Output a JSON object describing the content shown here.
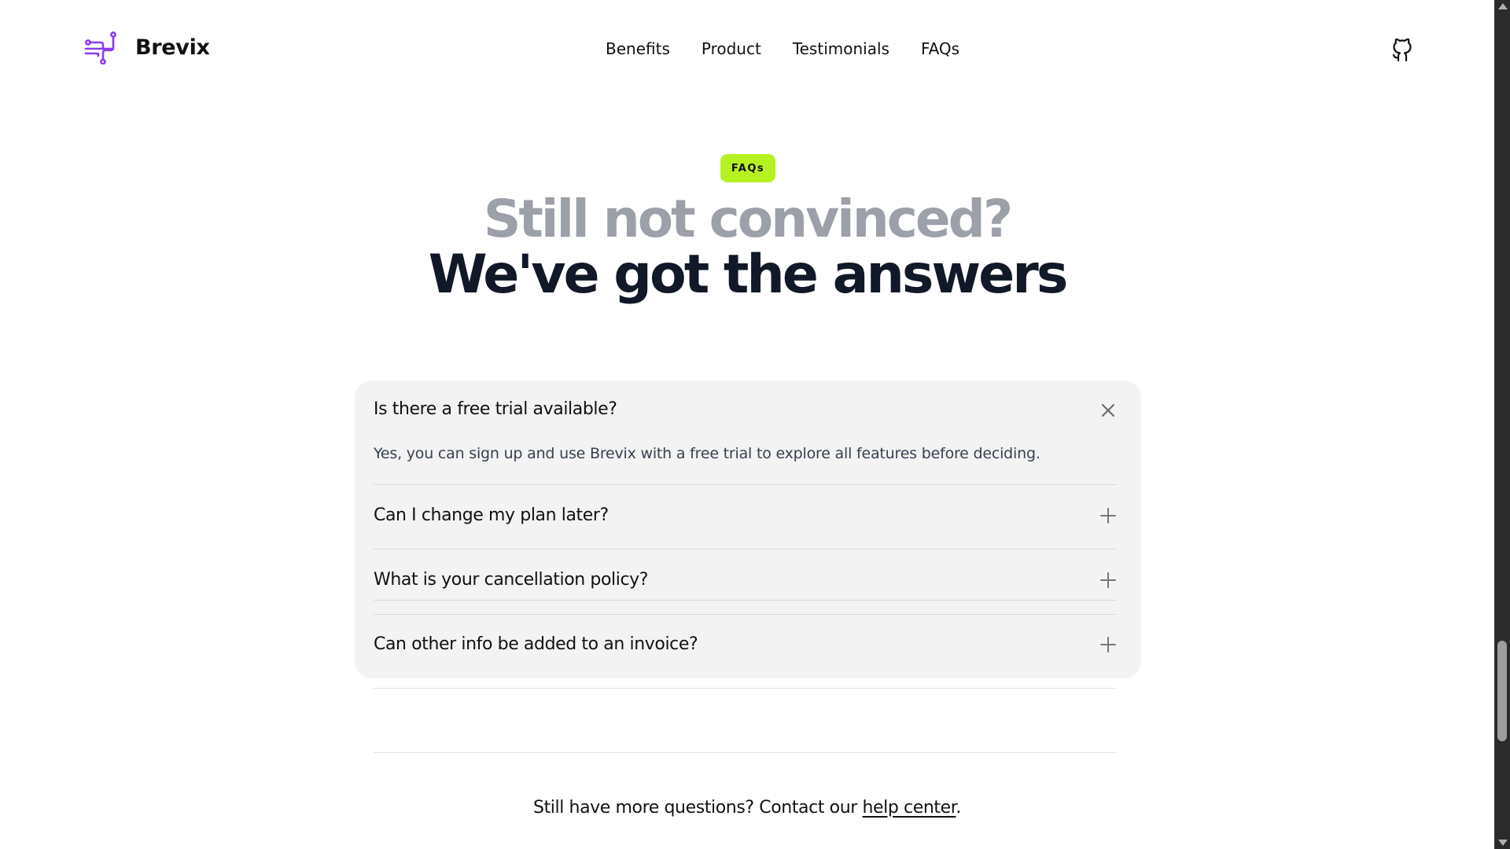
{
  "header": {
    "brand_name": "Brevix",
    "nav": [
      "Benefits",
      "Product",
      "Testimonials",
      "FAQs"
    ],
    "github_icon": "github-icon"
  },
  "hero": {
    "badge": "FAQs",
    "headline_light": "Still not convinced?",
    "headline_dark": "We've got the answers"
  },
  "faq": {
    "items": [
      {
        "question": "Is there a free trial available?",
        "answer": "Yes, you can sign up and use Brevix with a free trial to explore all features before deciding.",
        "expanded": true,
        "toggle_icon": "close-icon"
      },
      {
        "question": "Can I change my plan later?",
        "expanded": false,
        "toggle_icon": "plus-icon"
      },
      {
        "question": "What is your cancellation policy?",
        "expanded": false,
        "toggle_icon": "plus-icon"
      },
      {
        "question": "Can other info be added to an invoice?",
        "expanded": false,
        "toggle_icon": "plus-icon"
      }
    ]
  },
  "footer": {
    "text_before": "Still have more questions? Contact our ",
    "link": "help center",
    "text_after": "."
  },
  "colors": {
    "accent": "#b6f221",
    "brand_logo": "#8b3df0",
    "headline_light": "#9ca0a8",
    "headline_dark": "#111827",
    "card_bg": "#f3f3f3"
  }
}
